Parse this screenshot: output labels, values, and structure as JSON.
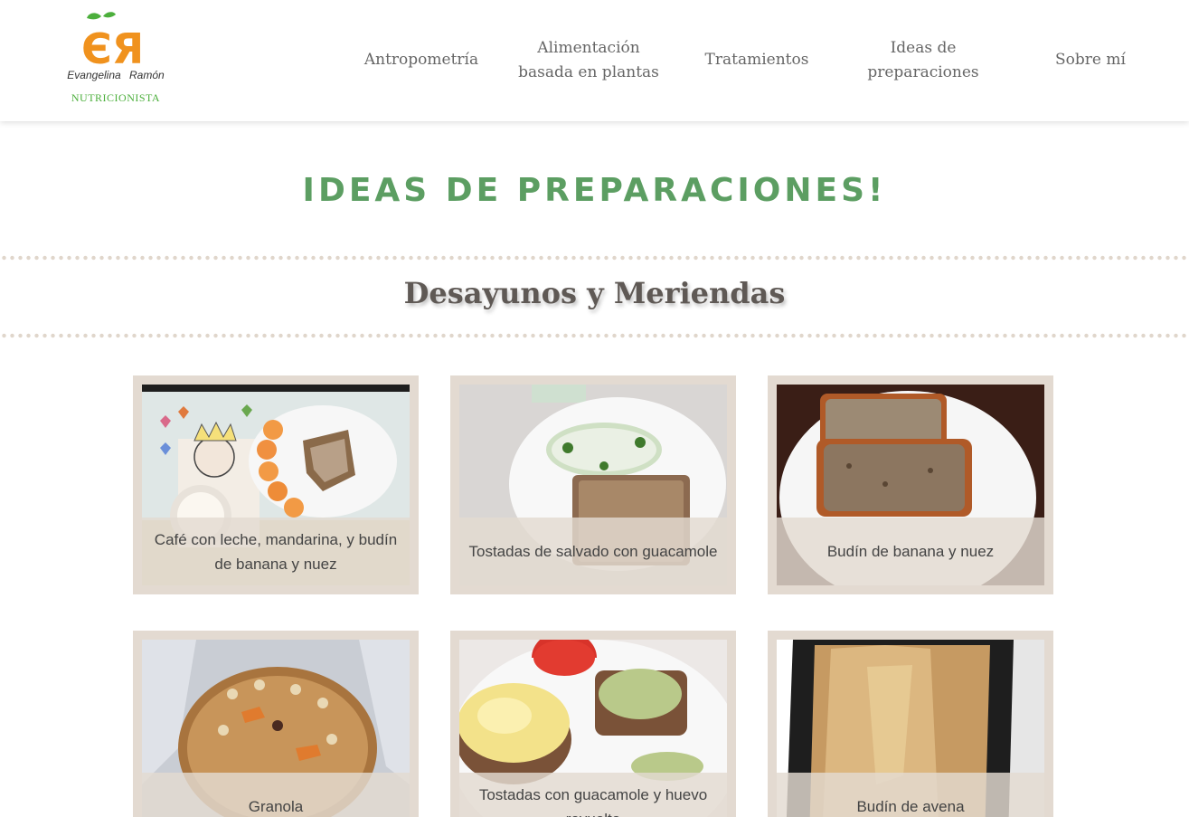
{
  "brand": {
    "logo_letters": "ЄЯ",
    "name": "Evangelina Ramón",
    "subtitle": "NUTRICIONISTA",
    "colors": {
      "orange": "#f0921e",
      "leaf": "#4caf3c"
    }
  },
  "nav": {
    "items": [
      {
        "label": "Antropometría"
      },
      {
        "label": "Alimentación basada en plantas"
      },
      {
        "label": "Tratamientos"
      },
      {
        "label": "Ideas de preparaciones"
      },
      {
        "label": "Sobre mí"
      }
    ]
  },
  "page": {
    "title": "IDEAS DE PREPARACIONES!",
    "section_title": "Desayunos y Meriendas",
    "title_color": "#5c9e62"
  },
  "cards": [
    {
      "caption": "Café con leche, mandarina, y budín de banana y nuez"
    },
    {
      "caption": "Tostadas de salvado con guacamole"
    },
    {
      "caption": "Budín de banana y nuez"
    },
    {
      "caption": "Granola"
    },
    {
      "caption": "Tostadas con guacamole y huevo revuelto"
    },
    {
      "caption": "Budín de avena"
    }
  ]
}
